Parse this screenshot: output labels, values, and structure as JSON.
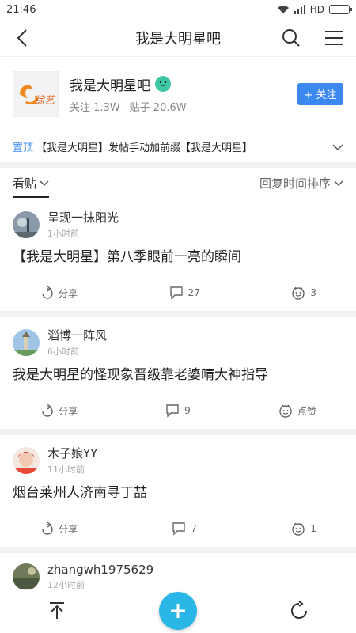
{
  "status": {
    "time": "21:46",
    "hd": "HD"
  },
  "nav": {
    "title": "我是大明星吧"
  },
  "forum": {
    "name": "我是大明星吧",
    "follow_label": "关注",
    "follow_label_short": "+ 关注",
    "followers": "关注 1.3W",
    "posts": "贴子 20.6W",
    "logo_text": "综艺"
  },
  "pinned": {
    "tag": "置顶",
    "text": "【我是大明星】发帖手动加前缀【我是大明星】"
  },
  "sort": {
    "left": "看贴",
    "right": "回复时间排序"
  },
  "posts": [
    {
      "author": "呈现一抹阳光",
      "time": "1小时前",
      "title": "【我是大明星】第八季眼前一亮的瞬间",
      "share": "分享",
      "comments": "27",
      "likes": "3"
    },
    {
      "author": "淄博一阵风",
      "time": "6小时前",
      "title": "我是大明星的怪现象晋级靠老婆晴大神指导",
      "share": "分享",
      "comments": "9",
      "likes": "点赞"
    },
    {
      "author": "木子娘YY",
      "time": "11小时前",
      "title": "烟台莱州人济南寻丁喆",
      "share": "分享",
      "comments": "7",
      "likes": "1"
    },
    {
      "author": "zhangwh1975629",
      "time": "12小时前",
      "title": ""
    }
  ],
  "colors": {
    "accent": "#3a88f0",
    "fab": "#2bb6e8",
    "pin": "#3a88f0"
  }
}
